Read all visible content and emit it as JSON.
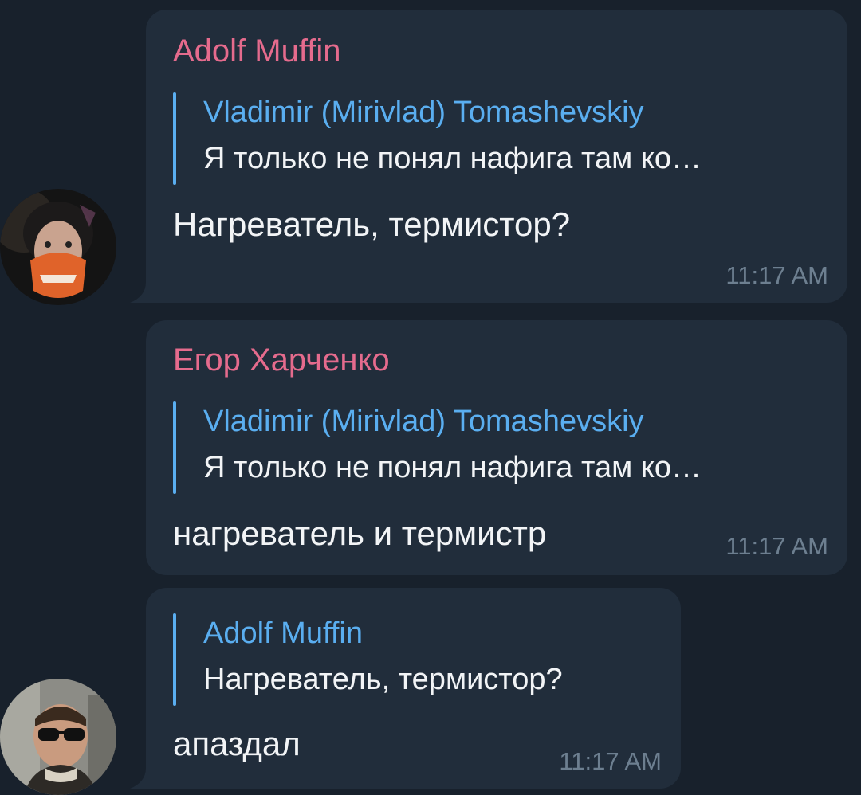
{
  "colors": {
    "background": "#18212c",
    "bubble": "#212d3b",
    "sender_name": "#e56b8d",
    "reply_accent": "#5aaef0",
    "text": "#f2f4f6",
    "timestamp": "#6d7f90"
  },
  "messages": [
    {
      "sender": "Adolf Muffin",
      "avatar": "avatar-orange-mask",
      "reply": {
        "author": "Vladimir (Mirivlad) Tomashevskiy",
        "text": "Я только не понял нафига там ко…"
      },
      "text": "Нагреватель, термистор?",
      "time": "11:17 AM"
    },
    {
      "sender": "Егор Харченко",
      "reply": {
        "author": "Vladimir (Mirivlad) Tomashevskiy",
        "text": "Я только не понял нафига там ко…"
      },
      "text": "нагреватель и термистр",
      "time": "11:17 AM"
    },
    {
      "avatar": "avatar-sunglasses",
      "reply": {
        "author": "Adolf Muffin",
        "text": "Нагреватель, термистор?"
      },
      "text": "апаздал",
      "time": "11:17 AM"
    }
  ]
}
